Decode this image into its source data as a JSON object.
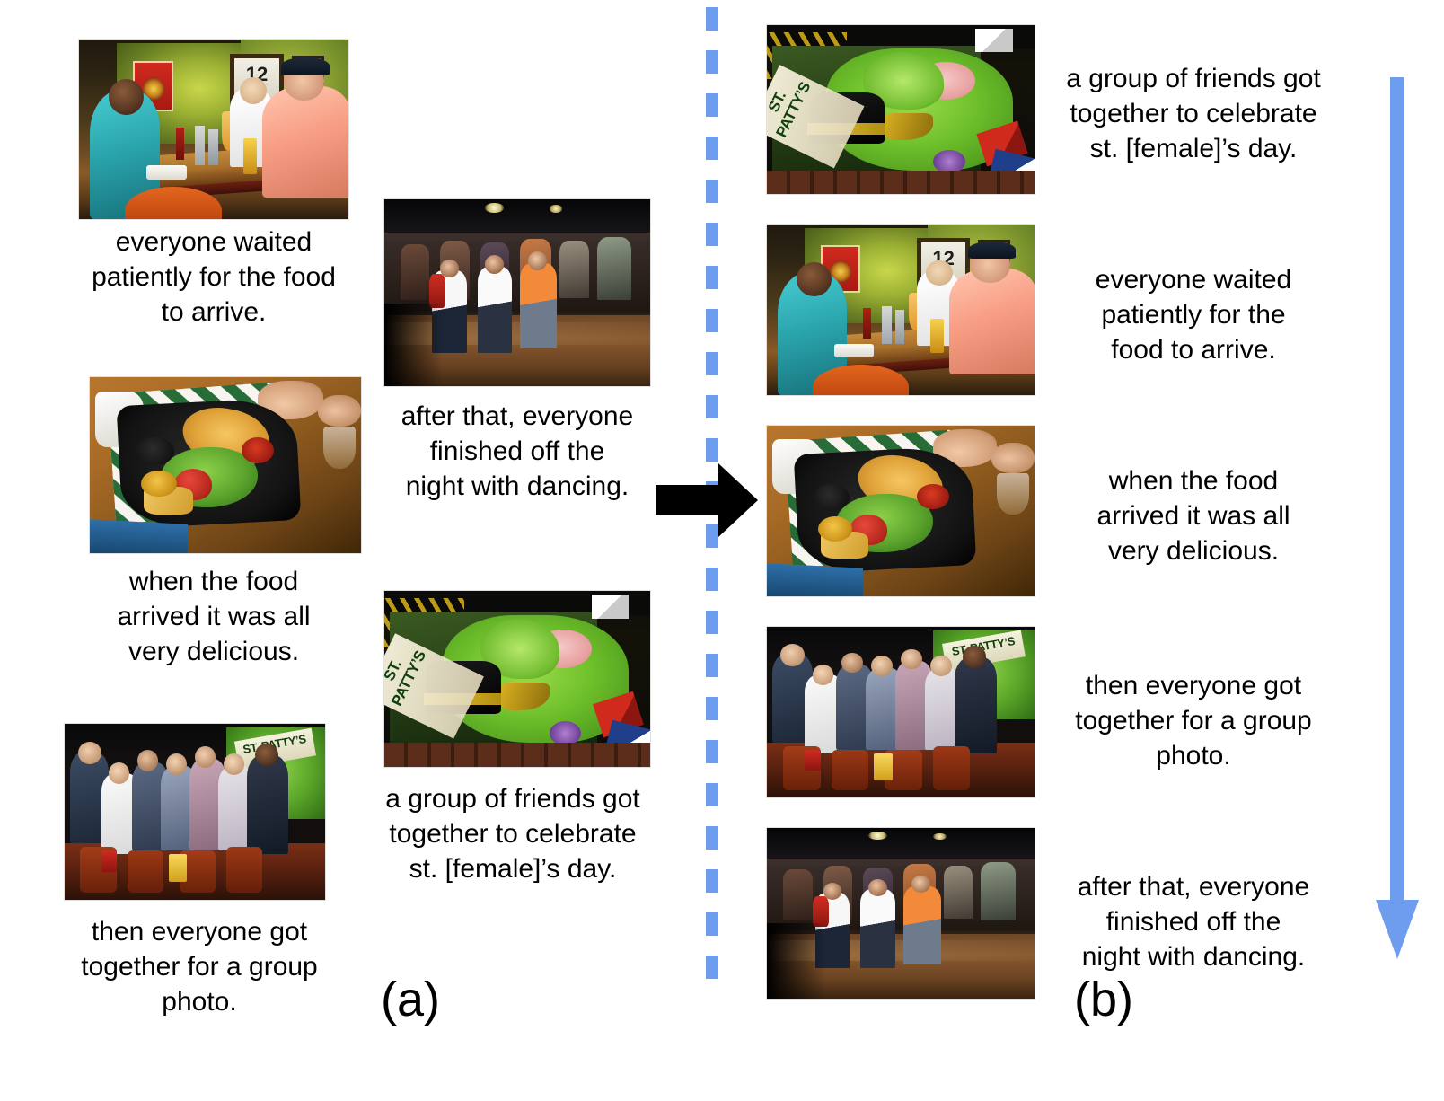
{
  "figure": {
    "type": "visual-storytelling-reordering",
    "panels": [
      {
        "id": "a",
        "label": "(a)",
        "description": "unordered image-caption set"
      },
      {
        "id": "b",
        "label": "(b)",
        "description": "reordered coherent story sequence"
      }
    ],
    "colors": {
      "divider": "#6e9cef",
      "flow_arrow": "#6e9cef",
      "transition_arrow": "#000000",
      "text": "#000000",
      "background": "#ffffff"
    }
  },
  "panel_a": {
    "label": "(a)",
    "items": [
      {
        "photo": "bar-table-photo",
        "photo_alt": "group seated at a restaurant table",
        "caption": "everyone waited\npatiently for the food\nto arrive."
      },
      {
        "photo": "dancing-photo",
        "photo_alt": "people dancing on a dance floor",
        "caption": "after that, everyone\nfinished off the\nnight with dancing."
      },
      {
        "photo": "food-platter-photo",
        "photo_alt": "platter of food with chips and dips",
        "caption": "when the food\narrived it was all\nvery delicious."
      },
      {
        "photo": "st-pattys-sign-photo",
        "photo_alt": "st. patty's day leprechaun sign",
        "caption": "a group of friends got\ntogether to celebrate\nst. [female]’s day."
      },
      {
        "photo": "group-photo",
        "photo_alt": "large group posing for a photo",
        "caption": "then everyone got\ntogether for a group\nphoto."
      }
    ]
  },
  "panel_b": {
    "label": "(b)",
    "items": [
      {
        "photo": "st-pattys-sign-photo",
        "photo_alt": "st. patty's day leprechaun sign",
        "caption": "a group of friends got\ntogether to celebrate\nst. [female]’s day."
      },
      {
        "photo": "bar-table-photo",
        "photo_alt": "group seated at a restaurant table",
        "caption": "everyone waited\npatiently for the\nfood to arrive."
      },
      {
        "photo": "food-platter-photo",
        "photo_alt": "platter of food with chips and dips",
        "caption": "when the food\narrived it was all\nvery delicious."
      },
      {
        "photo": "group-photo",
        "photo_alt": "large group posing for a photo",
        "caption": "then everyone got\ntogether for a group\nphoto."
      },
      {
        "photo": "dancing-photo",
        "photo_alt": "people dancing on a dance floor",
        "caption": "after that, everyone\nfinished off the\nnight with dancing."
      }
    ]
  },
  "sign_text": {
    "line": "ST. PATTY’S"
  }
}
